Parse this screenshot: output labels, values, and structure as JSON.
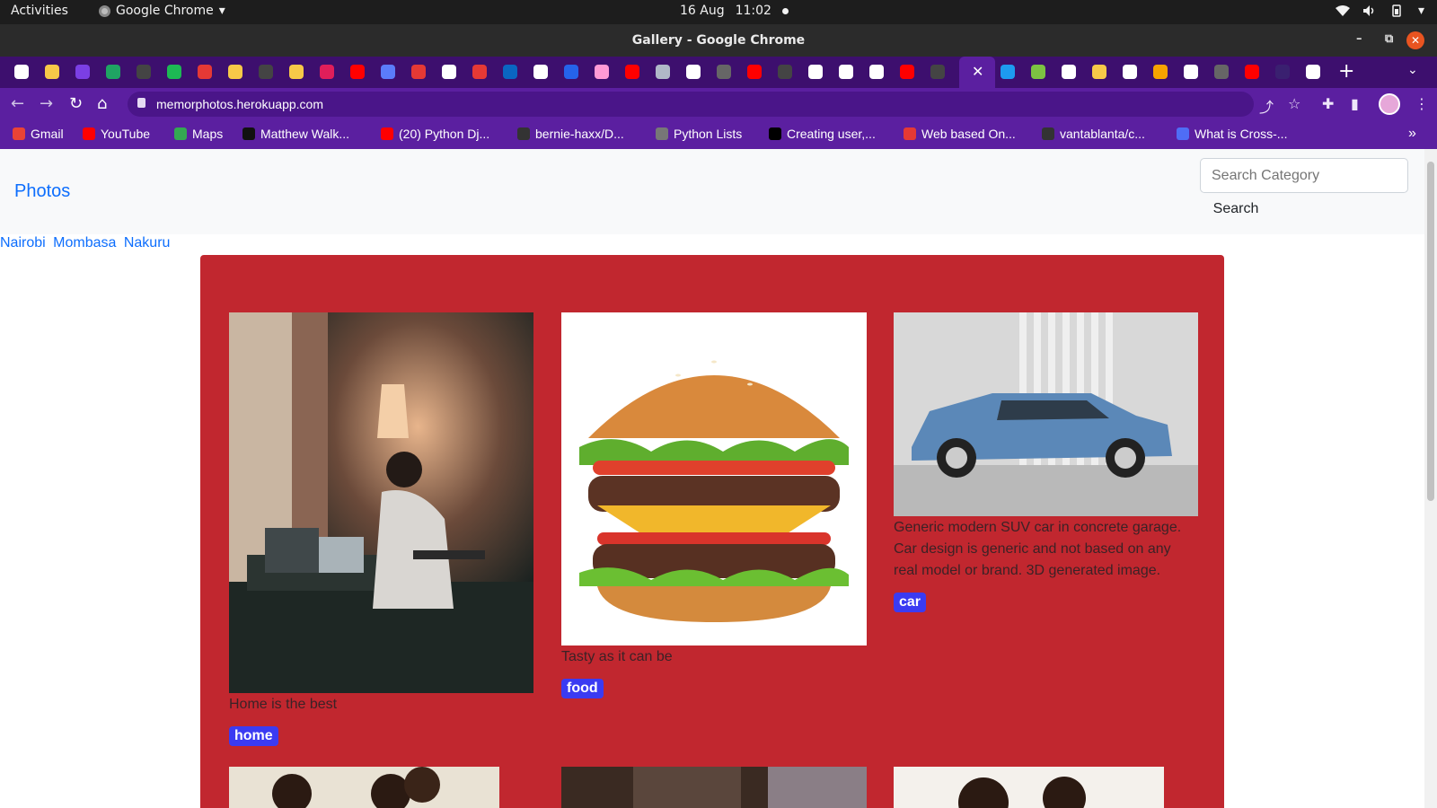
{
  "system_bar": {
    "activities": "Activities",
    "app_name": "Google Chrome",
    "date": "16 Aug",
    "time": "11:02"
  },
  "window": {
    "title": "Gallery - Google Chrome",
    "minimize_icon": "minimize-icon",
    "maximize_icon": "maximize-icon",
    "close_icon": "close-icon"
  },
  "tabs": {
    "favicon_colors": [
      "#ffffff",
      "#f7c948",
      "#7b3fe4",
      "#1fa463",
      "#444444",
      "#1db954",
      "#e53935",
      "#f7c948",
      "#444444",
      "#f7c948",
      "#e01e5a",
      "#ff0000",
      "#5b7cfa",
      "#e53935",
      "#ffffff",
      "#e53935",
      "#0a66c2",
      "#ffffff",
      "#2563eb",
      "#ff9ad5",
      "#ff0000",
      "#b0b8c8",
      "#ffffff",
      "#666666",
      "#ff0000",
      "#444444",
      "#ffffff",
      "#ffffff",
      "#ffffff",
      "#ff0000",
      "#444444"
    ],
    "favicon_colors_right": [
      "#1d9bf0",
      "#7cc242",
      "#ffffff",
      "#f7c948",
      "#ffffff",
      "#f7a300",
      "#ffffff",
      "#666666",
      "#ff0000",
      "#3a2070",
      "#ffffff"
    ],
    "new_tab": "+"
  },
  "toolbar": {
    "url": "memorphotos.herokuapp.com"
  },
  "bookmarks": [
    {
      "label": "Gmail",
      "color": "#ea4335"
    },
    {
      "label": "YouTube",
      "color": "#ff0000"
    },
    {
      "label": "Maps",
      "color": "#34a853"
    },
    {
      "label": "Matthew Walk...",
      "color": "#111111"
    },
    {
      "label": "(20) Python Dj...",
      "color": "#ff0000"
    },
    {
      "label": "bernie-haxx/D...",
      "color": "#333333"
    },
    {
      "label": "Python Lists",
      "color": "#777777"
    },
    {
      "label": "Creating user,...",
      "color": "#000000"
    },
    {
      "label": "Web based On...",
      "color": "#e53935"
    },
    {
      "label": "vantablanta/c...",
      "color": "#333333"
    },
    {
      "label": "What is Cross-...",
      "color": "#4f6df5"
    }
  ],
  "navbar": {
    "brand": "Photos",
    "search_placeholder": "Search Category",
    "search_button": "Search"
  },
  "locations": [
    "Nairobi",
    "Mombasa",
    "Nakuru"
  ],
  "colors": {
    "gallery_bg": "#c1272f",
    "badge_bg": "#3b3bf2",
    "link": "#0d6efd"
  },
  "photos": [
    {
      "description": "Home is the best",
      "category": "home"
    },
    {
      "description": "Tasty as it can be",
      "category": "food"
    },
    {
      "description": "Generic modern SUV car in concrete garage. Car design is generic and not based on any real model or brand. 3D generated image.",
      "category": "car"
    }
  ]
}
